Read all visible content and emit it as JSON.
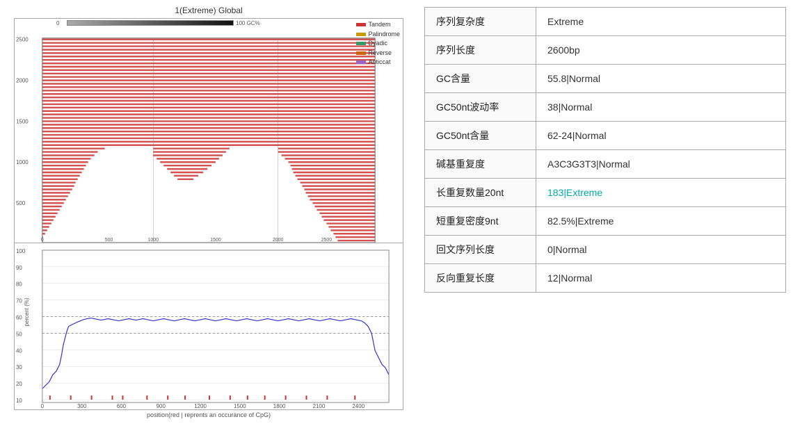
{
  "chart": {
    "title": "1(Extreme) Global",
    "legend": [
      {
        "label": "Tandem",
        "color": "#cc3333"
      },
      {
        "label": "Palindrome",
        "color": "#cc9900"
      },
      {
        "label": "Dyadic",
        "color": "#339966"
      },
      {
        "label": "Reverse",
        "color": "#cc6600"
      },
      {
        "label": "Anticcat",
        "color": "#9966cc"
      }
    ],
    "gc_bar_label": "100 GC%",
    "dot_x_labels": [
      "500",
      "1000",
      "1500",
      "2000",
      "2500"
    ],
    "gc_y_labels": [
      "100",
      "90",
      "80",
      "70",
      "60",
      "50",
      "40",
      "30",
      "20",
      "10"
    ],
    "gc_x_label": "position(red | reprents an occurance of CpG)",
    "gc_x_ticks": [
      "0",
      "300",
      "600",
      "900",
      "1200",
      "1500",
      "1800",
      "2100",
      "2400"
    ]
  },
  "table": {
    "rows": [
      {
        "label": "序列复杂度",
        "value": "Extreme",
        "class": ""
      },
      {
        "label": "序列长度",
        "value": "2600bp",
        "class": ""
      },
      {
        "label": "GC含量",
        "value": "55.8|Normal",
        "class": ""
      },
      {
        "label": "GC50nt波动率",
        "value": "38|Normal",
        "class": ""
      },
      {
        "label": "GC50nt含量",
        "value": "62-24|Normal",
        "class": ""
      },
      {
        "label": "碱基重复度",
        "value": "A3C3G3T3|Normal",
        "class": ""
      },
      {
        "label": "长重复数量20nt",
        "value": "183|Extreme",
        "class": "extreme"
      },
      {
        "label": "短重复密度9nt",
        "value": "82.5%|Extreme",
        "class": ""
      },
      {
        "label": "回文序列长度",
        "value": "0|Normal",
        "class": ""
      },
      {
        "label": "反向重复长度",
        "value": "12|Normal",
        "class": ""
      }
    ]
  }
}
